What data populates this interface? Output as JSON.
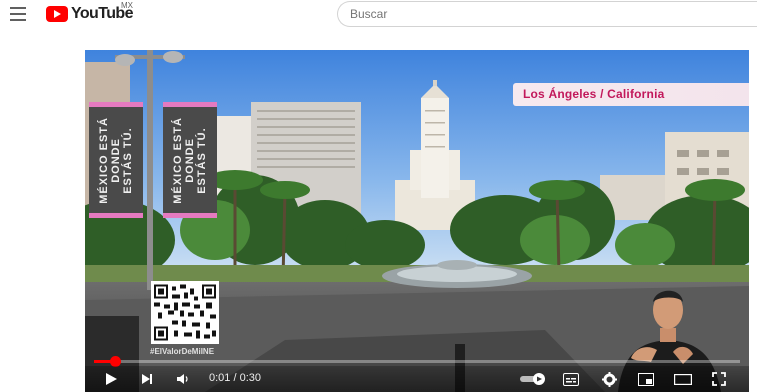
{
  "header": {
    "logo_text": "YouTube",
    "country_code": "MX",
    "search_placeholder": "Buscar"
  },
  "video": {
    "location_label": "Los Ángeles / California",
    "banner_left_text": "MÉXICO ESTÁ\nDONDE\nESTÁS TÚ.",
    "banner_right_text": "MÉXICO ESTÁ\nDONDE\nESTÁS TÚ.",
    "hashtag": "#ElValorDeMiINE",
    "progress_fraction": 0.033
  },
  "controls": {
    "time_display": "0:01 / 0:30",
    "icons": [
      "play-icon",
      "next-icon",
      "volume-icon",
      "autoplay-toggle-icon",
      "subtitles-icon",
      "settings-icon",
      "miniplayer-icon",
      "theater-mode-icon",
      "fullscreen-icon"
    ]
  },
  "colors": {
    "youtube_red": "#ff0000",
    "label_text": "#c2185b",
    "banner_trim": "#e57ac0"
  }
}
